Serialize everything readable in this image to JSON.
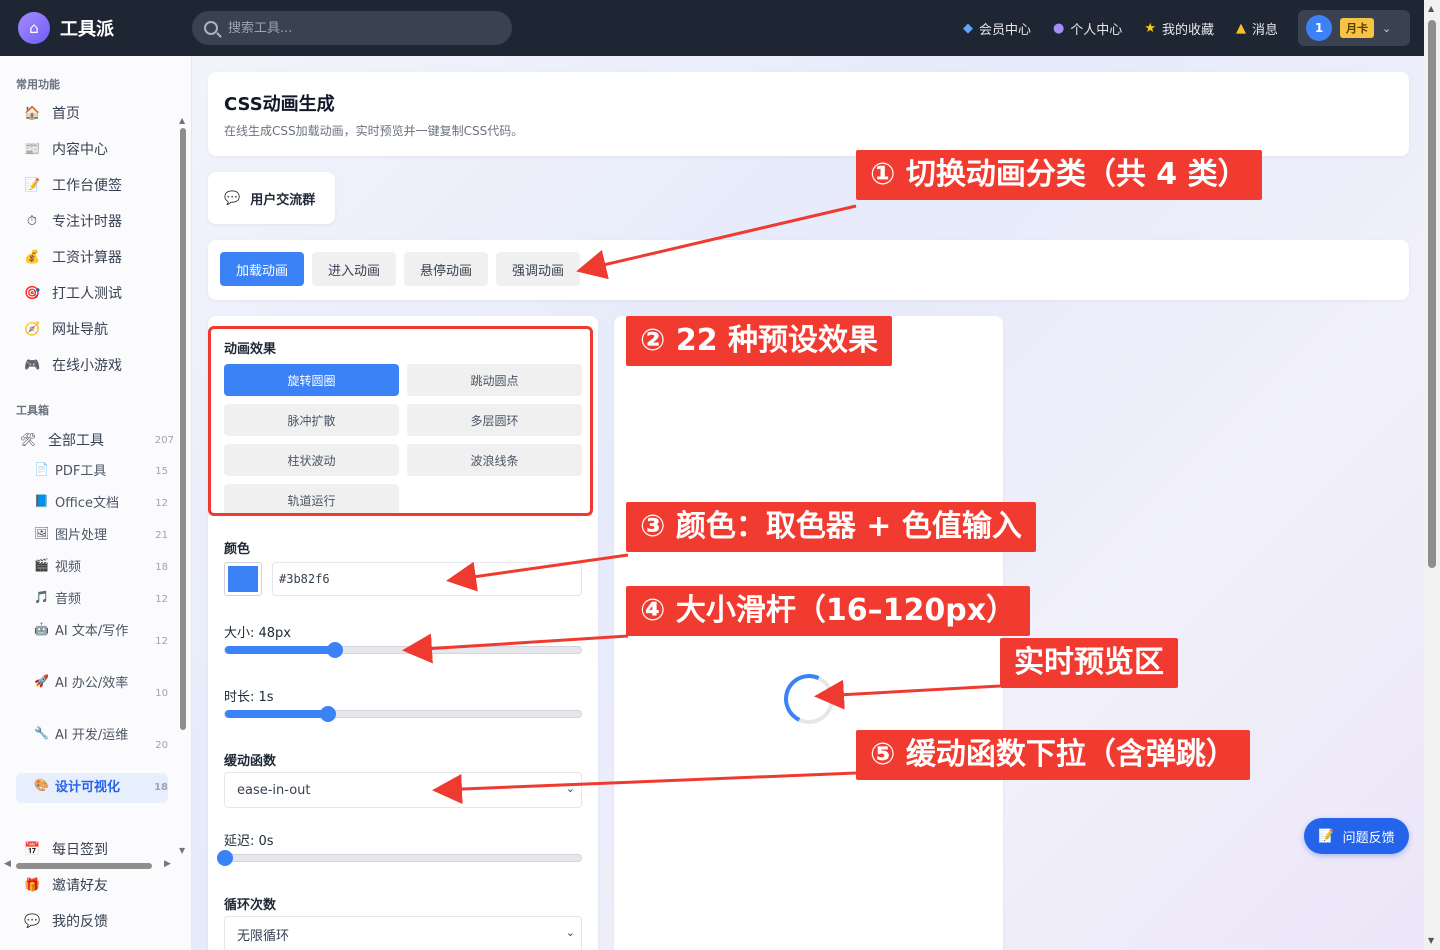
{
  "app": {
    "name": "工具派",
    "logo_icon": "briefcase-icon"
  },
  "search": {
    "placeholder": "搜索工具..."
  },
  "topnav": [
    {
      "label": "会员中心",
      "icon": "diamond-icon"
    },
    {
      "label": "个人中心",
      "icon": "user-icon"
    },
    {
      "label": "我的收藏",
      "icon": "star-icon"
    },
    {
      "label": "消息",
      "icon": "bell-icon"
    }
  ],
  "user": {
    "avatar": "1",
    "badge": "月卡"
  },
  "sidebar": {
    "section_common": "常用功能",
    "common": [
      {
        "label": "首页",
        "icon": "home-icon"
      },
      {
        "label": "内容中心",
        "icon": "newspaper-icon"
      },
      {
        "label": "工作台便签",
        "icon": "memo-icon"
      },
      {
        "label": "专注计时器",
        "icon": "stopwatch-icon"
      },
      {
        "label": "工资计算器",
        "icon": "money-bag-icon"
      },
      {
        "label": "打工人测试",
        "icon": "target-icon"
      },
      {
        "label": "网址导航",
        "icon": "compass-icon"
      },
      {
        "label": "在线小游戏",
        "icon": "gamepad-icon"
      }
    ],
    "section_tools": "工具箱",
    "all_tools": {
      "label": "全部工具",
      "count": "207",
      "icon": "tools-icon"
    },
    "sub": [
      {
        "label": "PDF工具",
        "count": "15",
        "icon": "pdf-icon"
      },
      {
        "label": "Office文档",
        "count": "12",
        "icon": "book-icon"
      },
      {
        "label": "图片处理",
        "count": "21",
        "icon": "picture-icon"
      },
      {
        "label": "视频",
        "count": "18",
        "icon": "clapper-icon"
      },
      {
        "label": "音频",
        "count": "12",
        "icon": "music-icon"
      },
      {
        "label": "AI 文本/写作",
        "count": "12",
        "icon": "robot-icon"
      },
      {
        "label": "AI 办公/效率",
        "count": "10",
        "icon": "rocket-icon"
      },
      {
        "label": "AI 开发/运维",
        "count": "20",
        "icon": "wrench-icon"
      },
      {
        "label": "设计可视化",
        "count": "18",
        "icon": "palette-icon"
      }
    ],
    "bottom": [
      {
        "label": "每日签到",
        "icon": "calendar-icon"
      },
      {
        "label": "邀请好友",
        "icon": "gift-icon"
      },
      {
        "label": "我的反馈",
        "icon": "speech-icon"
      }
    ]
  },
  "page": {
    "title": "CSS动画生成",
    "subtitle": "在线生成CSS加载动画，实时预览并一键复制CSS代码。",
    "group_button": "用户交流群"
  },
  "tabs": [
    "加载动画",
    "进入动画",
    "悬停动画",
    "强调动画"
  ],
  "effects": {
    "label": "动画效果",
    "items": [
      "旋转圆圈",
      "跳动圆点",
      "脉冲扩散",
      "多层圆环",
      "柱状波动",
      "波浪线条",
      "轨道运行"
    ]
  },
  "controls": {
    "color_label": "颜色",
    "color_value": "#3b82f6",
    "size_label": "大小: 48px",
    "size_fraction": 0.31,
    "duration_label": "时长: 1s",
    "duration_fraction": 0.29,
    "easing_label": "缓动函数",
    "easing_value": "ease-in-out",
    "delay_label": "延迟: 0s",
    "delay_fraction": 0.0,
    "loop_label": "循环次数",
    "loop_value": "无限循环"
  },
  "feedback": {
    "label": "问题反馈",
    "icon": "note-icon"
  },
  "annotations": [
    "① 切换动画分类（共 4 类）",
    "② 22 种预设效果",
    "③ 颜色：取色器 + 色值输入",
    "④ 大小滑杆（16–120px）",
    "实时预览区",
    "⑤ 缓动函数下拉（含弹跳）"
  ],
  "colors": {
    "accent": "#3b82f6",
    "annotation": "#f23b30",
    "topbar": "#1e2533"
  }
}
